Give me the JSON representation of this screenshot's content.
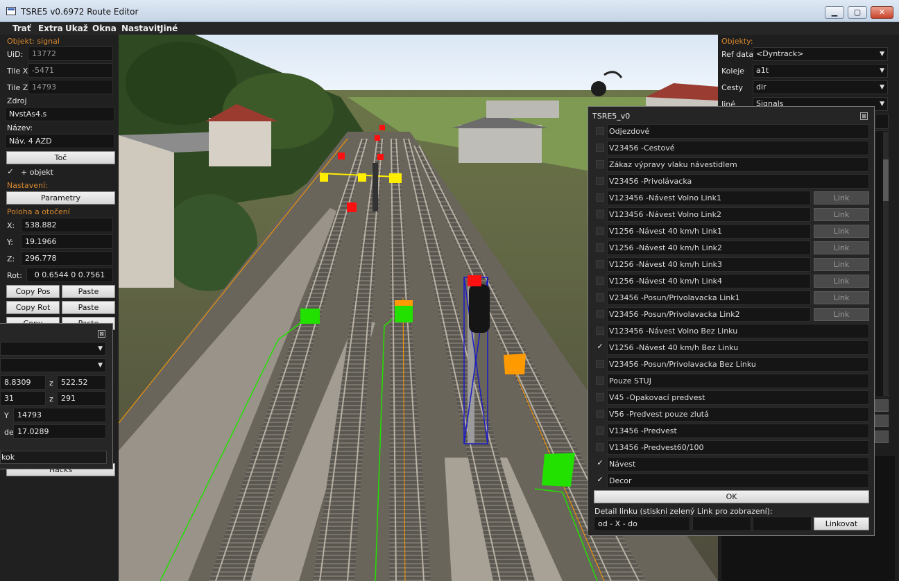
{
  "window": {
    "title": "TSRE5 v0.6972 Route Editor"
  },
  "menu": [
    "Trať",
    "Extra",
    "Ukaž",
    "Okna",
    "Nastavit",
    "Jiné"
  ],
  "left": {
    "object_header": "Objekt: signal",
    "uid_label": "UiD:",
    "uid": "13772",
    "tilex_label": "Tile X:",
    "tilex": "-5471",
    "tilez_label": "Tile Z:",
    "tilez": "14793",
    "source_label": "Zdroj",
    "source": "NvstAs4.s",
    "name_label": "Název:",
    "name": "Náv. 4 AZD",
    "rotate_btn": "Toč",
    "plus_object": "+ objekt",
    "settings_header": "Nastavení:",
    "params_btn": "Parametry",
    "pos_header": "Poloha a otočení",
    "x_label": "X:",
    "x": "538.882",
    "y_label": "Y:",
    "y": "19.1966",
    "z_label": "Z:",
    "z": "296.778",
    "rot_label": "Rot:",
    "rot": "0 0.6544 0 0.7561",
    "copy_pos": "Copy Pos",
    "paste1": "Paste",
    "copy_rot": "Copy Rot",
    "paste2": "Paste",
    "copy_posrot_partial": "Copy Pos+Rot",
    "paste3_partial": "Paste",
    "hacks_partial": "Hacks"
  },
  "small_dialog": {
    "close": "⊠",
    "row3_left": "8.8309",
    "row3_z": "z",
    "row3_right": "522.52",
    "row4_left": "31",
    "row4_z": "z",
    "row4_right": "291",
    "row5_y": "Y",
    "row5_val": "14793",
    "row6_del": "del",
    "row6_val": "17.0289",
    "ok_partial": "kok"
  },
  "right": {
    "header": "Objekty:",
    "ref_label": "Ref data",
    "ref_value": "<Dyntrack>",
    "tracks_label": "Koleje",
    "tracks_value": "a1t",
    "roads_label": "Cesty",
    "roads_value": "dir",
    "other_label": "Jiné",
    "other_value": "Signals"
  },
  "signal_dialog": {
    "title": "TSRE5_v0",
    "close": "⊠",
    "link_label": "Link",
    "rows": [
      {
        "label": "Odjezdové",
        "checked": false,
        "link": false
      },
      {
        "label": "V23456 -Cestové",
        "checked": false,
        "link": false
      },
      {
        "label": "Zákaz výpravy vlaku návestidlem",
        "checked": false,
        "link": false
      },
      {
        "label": "V23456 -Privolávacka",
        "checked": false,
        "link": false
      },
      {
        "label": "V123456 -Návest Volno Link1",
        "checked": false,
        "link": true
      },
      {
        "label": "V123456 -Návest Volno Link2",
        "checked": false,
        "link": true
      },
      {
        "label": "V1256 -Návest 40 km/h Link1",
        "checked": false,
        "link": true
      },
      {
        "label": "V1256 -Návest 40 km/h Link2",
        "checked": false,
        "link": true
      },
      {
        "label": "V1256 -Návest 40 km/h Link3",
        "checked": false,
        "link": true
      },
      {
        "label": "V1256 -Návest 40 km/h Link4",
        "checked": false,
        "link": true
      },
      {
        "label": "V23456 -Posun/Privolavacka Link1",
        "checked": false,
        "link": true
      },
      {
        "label": "V23456 -Posun/Privolavacka Link2",
        "checked": false,
        "link": true
      },
      {
        "label": "V123456 -Návest Volno Bez Linku",
        "checked": false,
        "link": false
      },
      {
        "label": "V1256 -Návest 40 km/h Bez Linku",
        "checked": true,
        "link": false
      },
      {
        "label": "V23456 -Posun/Privolavacka Bez Linku",
        "checked": false,
        "link": false
      },
      {
        "label": "Pouze STUJ",
        "checked": false,
        "link": false
      },
      {
        "label": "V45 -Opakovací predvest",
        "checked": false,
        "link": false
      },
      {
        "label": "V56 -Predvest pouze zlutá",
        "checked": false,
        "link": false
      },
      {
        "label": "V13456 -Predvest",
        "checked": false,
        "link": false
      },
      {
        "label": "V13456 -Predvest60/100",
        "checked": false,
        "link": false
      },
      {
        "label": "Návest",
        "checked": true,
        "link": false
      },
      {
        "label": "Decor",
        "checked": true,
        "link": false
      }
    ],
    "ok": "OK",
    "detail_label": "Detail linku (stiskni zelený Link pro zobrazení):",
    "od_x_do": "od - X - do",
    "linkovat": "Linkovat"
  },
  "colors": {
    "section_orange": "#d9892f",
    "marker_green": "#22e000",
    "marker_red": "#ff1010",
    "marker_yellow": "#ffee00",
    "marker_orange": "#ff9a00"
  }
}
